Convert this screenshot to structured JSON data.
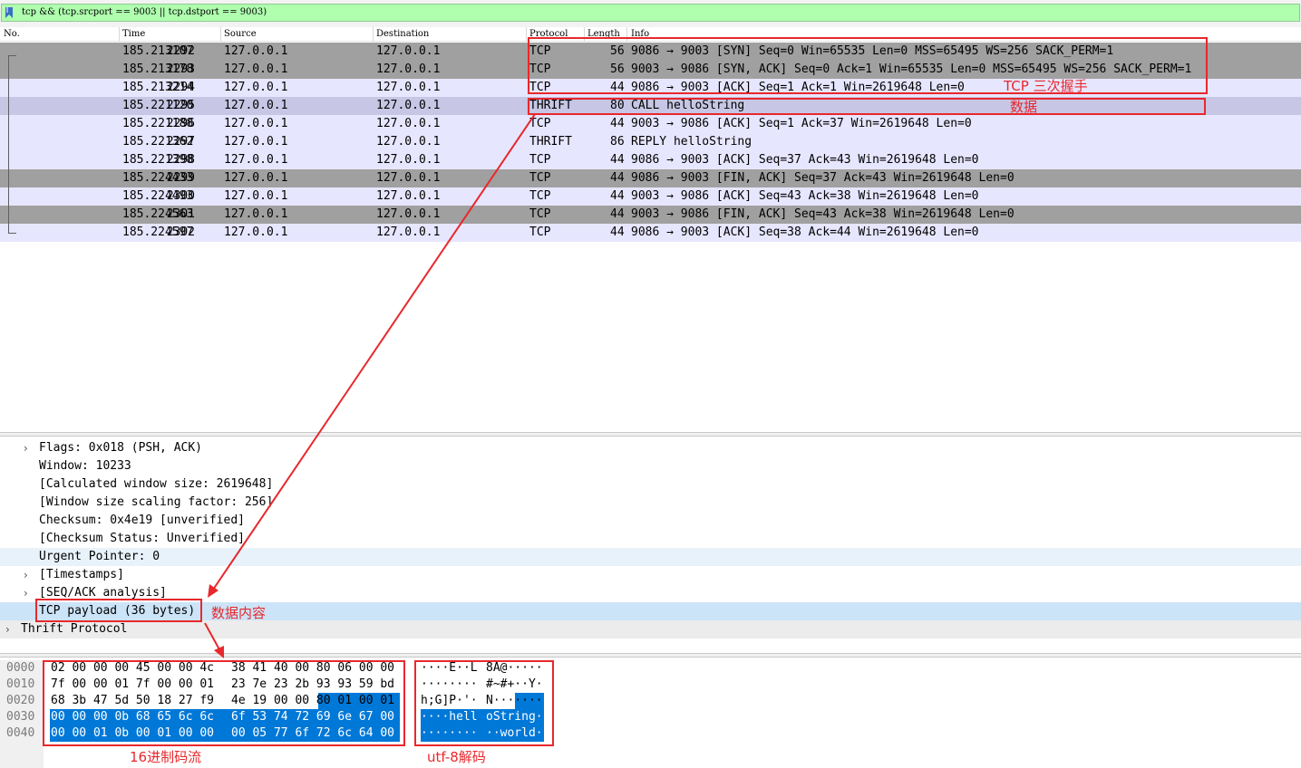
{
  "filter": {
    "text": "tcp && (tcp.srcport == 9003 || tcp.dstport == 9003)"
  },
  "columns": [
    "No.",
    "Time",
    "Source",
    "Destination",
    "Protocol",
    "Length",
    "Info"
  ],
  "packets": [
    {
      "no": "2292",
      "time": "185.213107",
      "src": "127.0.0.1",
      "dst": "127.0.0.1",
      "proto": "TCP",
      "len": "56",
      "info": "9086 → 9003 [SYN] Seq=0 Win=65535 Len=0 MSS=65495 WS=256 SACK_PERM=1",
      "style": "gray"
    },
    {
      "no": "2293",
      "time": "185.213178",
      "src": "127.0.0.1",
      "dst": "127.0.0.1",
      "proto": "TCP",
      "len": "56",
      "info": "9003 → 9086 [SYN, ACK] Seq=0 Ack=1 Win=65535 Len=0 MSS=65495 WS=256 SACK_PERM=1",
      "style": "gray"
    },
    {
      "no": "2294",
      "time": "185.213214",
      "src": "127.0.0.1",
      "dst": "127.0.0.1",
      "proto": "TCP",
      "len": "44",
      "info": "9086 → 9003 [ACK] Seq=1 Ack=1 Win=2619648 Len=0",
      "style": "light"
    },
    {
      "no": "2295",
      "time": "185.221120",
      "src": "127.0.0.1",
      "dst": "127.0.0.1",
      "proto": "THRIFT",
      "len": "80",
      "info": "CALL helloString",
      "style": "sel"
    },
    {
      "no": "2296",
      "time": "185.221188",
      "src": "127.0.0.1",
      "dst": "127.0.0.1",
      "proto": "TCP",
      "len": "44",
      "info": "9003 → 9086 [ACK] Seq=1 Ack=37 Win=2619648 Len=0",
      "style": "light"
    },
    {
      "no": "2297",
      "time": "185.221362",
      "src": "127.0.0.1",
      "dst": "127.0.0.1",
      "proto": "THRIFT",
      "len": "86",
      "info": "REPLY helloString",
      "style": "light"
    },
    {
      "no": "2298",
      "time": "185.221398",
      "src": "127.0.0.1",
      "dst": "127.0.0.1",
      "proto": "TCP",
      "len": "44",
      "info": "9086 → 9003 [ACK] Seq=37 Ack=43 Win=2619648 Len=0",
      "style": "light"
    },
    {
      "no": "2299",
      "time": "185.224433",
      "src": "127.0.0.1",
      "dst": "127.0.0.1",
      "proto": "TCP",
      "len": "44",
      "info": "9086 → 9003 [FIN, ACK] Seq=37 Ack=43 Win=2619648 Len=0",
      "style": "gray"
    },
    {
      "no": "2300",
      "time": "185.224493",
      "src": "127.0.0.1",
      "dst": "127.0.0.1",
      "proto": "TCP",
      "len": "44",
      "info": "9003 → 9086 [ACK] Seq=43 Ack=38 Win=2619648 Len=0",
      "style": "light"
    },
    {
      "no": "2301",
      "time": "185.224563",
      "src": "127.0.0.1",
      "dst": "127.0.0.1",
      "proto": "TCP",
      "len": "44",
      "info": "9003 → 9086 [FIN, ACK] Seq=43 Ack=38 Win=2619648 Len=0",
      "style": "gray"
    },
    {
      "no": "2302",
      "time": "185.224597",
      "src": "127.0.0.1",
      "dst": "127.0.0.1",
      "proto": "TCP",
      "len": "44",
      "info": "9086 → 9003 [ACK] Seq=38 Ack=44 Win=2619648 Len=0",
      "style": "light"
    }
  ],
  "details": [
    {
      "chev": "›",
      "text": "Flags: 0x018 (PSH, ACK)",
      "indent": 1,
      "style": ""
    },
    {
      "chev": "",
      "text": "Window: 10233",
      "indent": 1,
      "style": ""
    },
    {
      "chev": "",
      "text": "[Calculated window size: 2619648]",
      "indent": 1,
      "style": ""
    },
    {
      "chev": "",
      "text": "[Window size scaling factor: 256]",
      "indent": 1,
      "style": ""
    },
    {
      "chev": "",
      "text": "Checksum: 0x4e19 [unverified]",
      "indent": 1,
      "style": ""
    },
    {
      "chev": "",
      "text": "[Checksum Status: Unverified]",
      "indent": 1,
      "style": ""
    },
    {
      "chev": "",
      "text": "Urgent Pointer: 0",
      "indent": 1,
      "style": "hl"
    },
    {
      "chev": "›",
      "text": "[Timestamps]",
      "indent": 1,
      "style": ""
    },
    {
      "chev": "›",
      "text": "[SEQ/ACK analysis]",
      "indent": 1,
      "style": ""
    },
    {
      "chev": "",
      "text": "TCP payload (36 bytes)",
      "indent": 1,
      "style": "sel"
    },
    {
      "chev": "›",
      "text": "Thrift Protocol",
      "indent": 0,
      "style": "gray"
    }
  ],
  "bytes": {
    "offsets": [
      "0000",
      "0010",
      "0020",
      "0030",
      "0040"
    ],
    "hex_left": [
      "02 00 00 00 45 00 00 4c",
      "7f 00 00 01 7f 00 00 01",
      "68 3b 47 5d 50 18 27 f9",
      "00 00 00 0b 68 65 6c 6c",
      "00 00 01 0b 00 01 00 00"
    ],
    "hex_right": [
      "38 41 40 00 80 06 00 00",
      "23 7e 23 2b 93 93 59 bd",
      "4e 19 00 00 80 01 00 01",
      "6f 53 74 72 69 6e 67 00",
      "00 05 77 6f 72 6c 64 00"
    ],
    "ascii_left": [
      "····E··L",
      "········",
      "h;G]P·'·",
      "····hell",
      "········"
    ],
    "ascii_right": [
      "8A@·····",
      "#~#+··Y·",
      "N·······",
      "oString·",
      "··world·"
    ]
  },
  "annotations": {
    "handshake": "TCP 三次握手",
    "data": "数据",
    "payload": "数据内容",
    "hex_stream": "16进制码流",
    "utf8": "utf-8解码"
  },
  "colors": {
    "annotation": "#e8282d",
    "filter_ok": "#afffaf",
    "byte_highlight": "#0078d7"
  }
}
